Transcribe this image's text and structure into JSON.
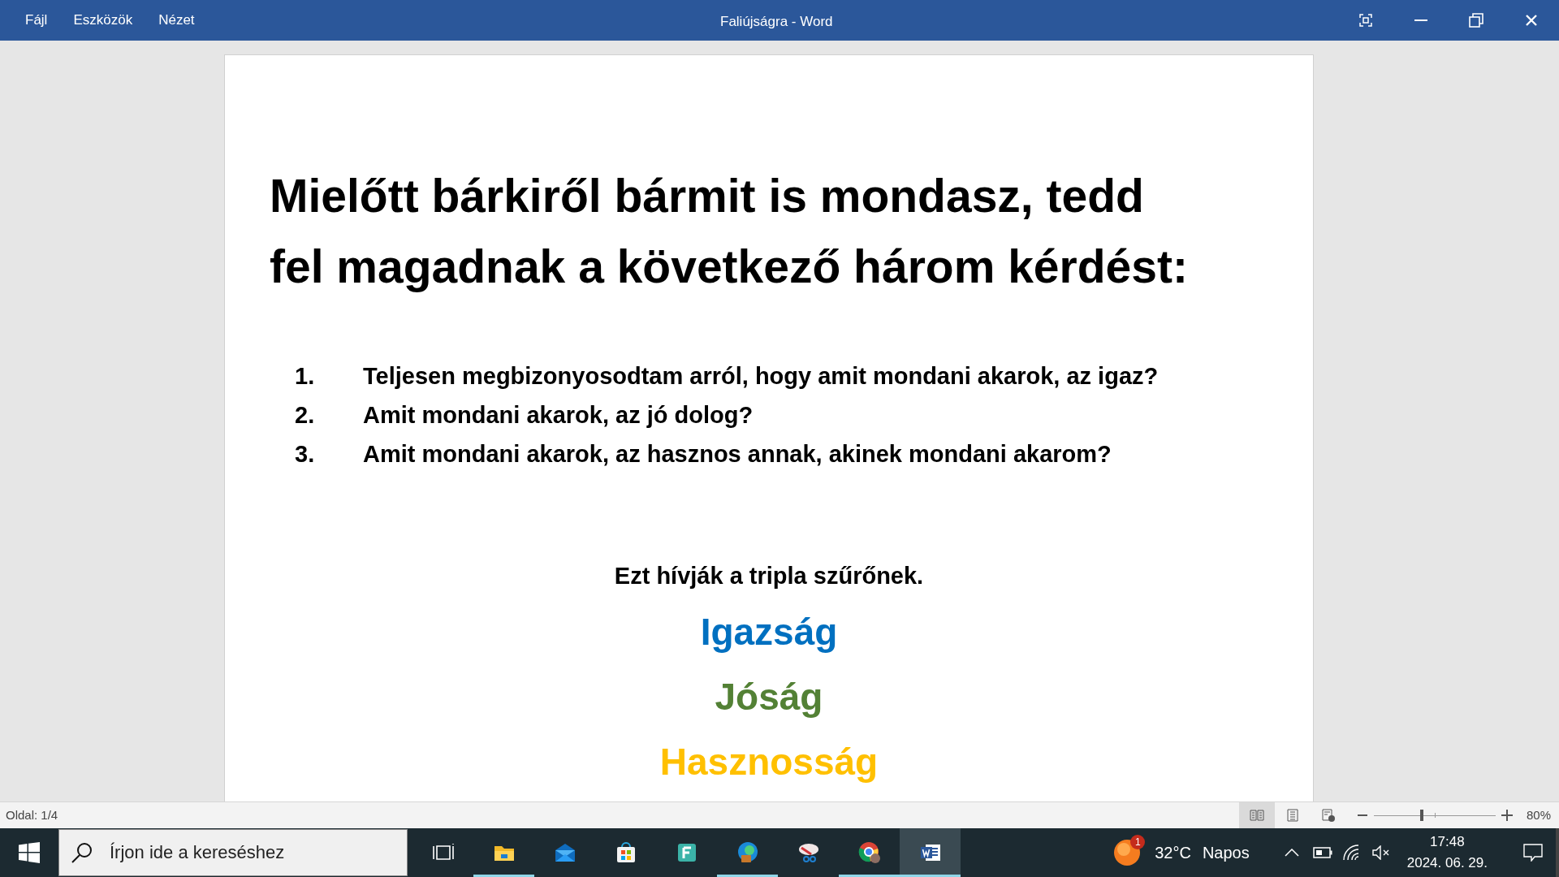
{
  "menu": [
    "Fájl",
    "Eszközök",
    "Nézet"
  ],
  "window": {
    "title": "Faliújságra - Word"
  },
  "document": {
    "heading": "Mielőtt bárkiről bármit is mondasz, tedd fel magadnak a következő három kérdést:",
    "questions": [
      {
        "number": "1.",
        "text": "Teljesen megbizonyosodtam arról, hogy amit mondani akarok, az igaz?"
      },
      {
        "number": "2.",
        "text": "Amit mondani akarok, az jó dolog?"
      },
      {
        "number": "3.",
        "text": "Amit mondani akarok, az hasznos annak, akinek mondani akarom?"
      }
    ],
    "caption": "Ezt hívják a tripla szűrőnek.",
    "filters": [
      {
        "text": "Igazság",
        "color": "#0070c0"
      },
      {
        "text": "Jóság",
        "color": "#538135"
      },
      {
        "text": "Hasznosság",
        "color": "#ffc000"
      }
    ]
  },
  "status_bar": {
    "page": "Oldal: 1/4",
    "views": [
      {
        "kind": "read",
        "selected": true
      },
      {
        "kind": "print",
        "selected": false
      },
      {
        "kind": "web",
        "selected": false
      }
    ],
    "zoom": {
      "level": 0.39,
      "reading": "80%"
    }
  },
  "taskbar": {
    "search": {
      "placeholder": "Írjon ide a kereséshez"
    },
    "apps": [
      {
        "kind": "taskview",
        "running": false,
        "selected": false
      },
      {
        "kind": "folder",
        "running": true,
        "selected": false
      },
      {
        "kind": "mail",
        "running": false,
        "selected": false
      },
      {
        "kind": "store",
        "running": false,
        "selected": false
      },
      {
        "kind": "f",
        "running": false,
        "selected": false
      },
      {
        "kind": "edge",
        "running": true,
        "selected": false
      },
      {
        "kind": "snip",
        "running": false,
        "selected": false
      },
      {
        "kind": "chrome",
        "running": true,
        "selected": false
      },
      {
        "kind": "word",
        "running": true,
        "selected": true
      }
    ],
    "weather": {
      "badge": "1",
      "temperature": "32°C",
      "condition": "Napos"
    },
    "time": "17:48",
    "date": "2024. 06. 29."
  }
}
